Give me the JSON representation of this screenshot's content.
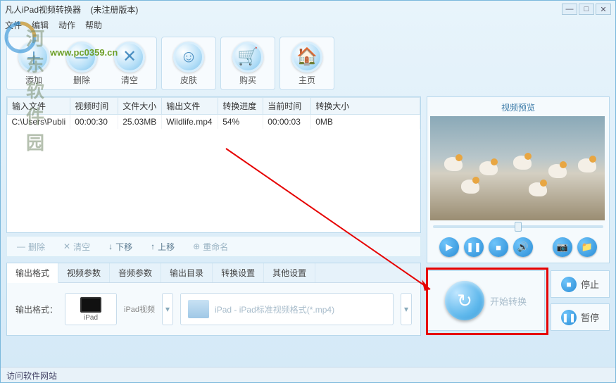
{
  "window": {
    "title": "凡人iPad视频转换器",
    "subtitle": "(未注册版本)"
  },
  "menu": {
    "file": "文件",
    "edit": "编辑",
    "action": "动作",
    "help": "帮助"
  },
  "watermark": {
    "text": "河东软件园",
    "url": "www.pc0359.cn"
  },
  "toolbar": {
    "add": "添加",
    "delete": "删除",
    "clear": "清空",
    "skin": "皮肤",
    "buy": "购买",
    "home": "主页"
  },
  "table": {
    "headers": {
      "input": "输入文件",
      "vtime": "视频时间",
      "fsize": "文件大小",
      "output": "输出文件",
      "progress": "转换进度",
      "ctime": "当前时间",
      "csize": "转换大小"
    },
    "rows": [
      {
        "input": "C:\\Users\\Publi",
        "vtime": "00:00:30",
        "fsize": "25.03MB",
        "output": "Wildlife.mp4",
        "progress": "54%",
        "ctime": "00:00:03",
        "csize": "0MB"
      }
    ]
  },
  "list_actions": {
    "delete": "删除",
    "clear": "清空",
    "down": "下移",
    "up": "上移",
    "rename": "重命名"
  },
  "tabs": {
    "t0": "输出格式",
    "t1": "视频参数",
    "t2": "音频参数",
    "t3": "输出目录",
    "t4": "转换设置",
    "t5": "其他设置"
  },
  "output": {
    "label": "输出格式：",
    "device_label": "iPad视频",
    "device_sub": "iPad",
    "format_text": "iPad - iPad标准视频格式(*.mp4)"
  },
  "preview": {
    "title": "视频预览"
  },
  "actions": {
    "start": "开始转换",
    "stop": "停止",
    "pause": "暂停"
  },
  "status": {
    "text": "访问软件网站"
  }
}
